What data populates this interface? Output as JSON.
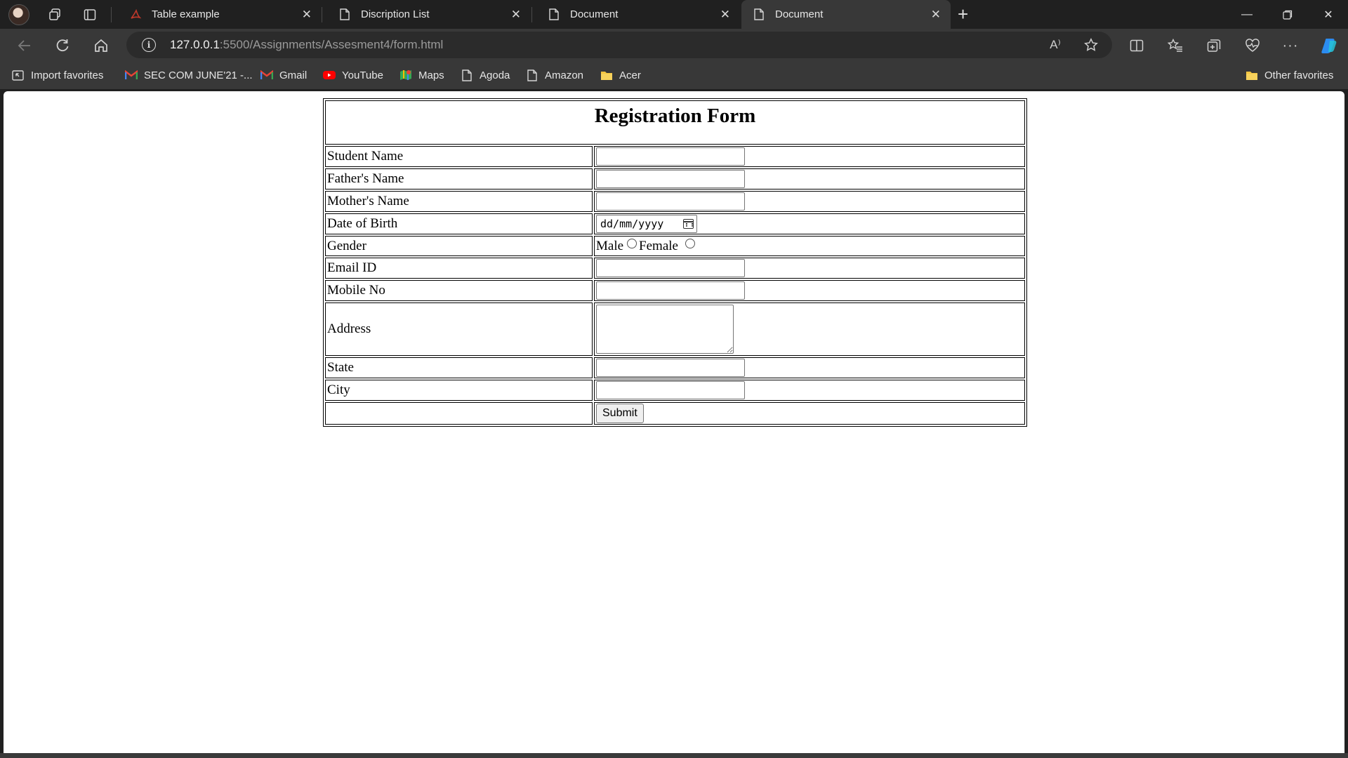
{
  "browser": {
    "tabs": [
      {
        "label": "Table example",
        "active": false
      },
      {
        "label": "Discription List",
        "active": false
      },
      {
        "label": "Document",
        "active": false
      },
      {
        "label": "Document",
        "active": true
      }
    ],
    "url_host": "127.0.0.1",
    "url_rest": ":5500/Assignments/Assesment4/form.html",
    "favorites": [
      {
        "label": "Import favorites",
        "icon": "import-icon"
      },
      {
        "label": "SEC COM JUNE'21 -...",
        "icon": "gmail-icon"
      },
      {
        "label": "Gmail",
        "icon": "gmail-icon"
      },
      {
        "label": "YouTube",
        "icon": "youtube-icon"
      },
      {
        "label": "Maps",
        "icon": "maps-icon"
      },
      {
        "label": "Agoda",
        "icon": "page-icon"
      },
      {
        "label": "Amazon",
        "icon": "page-icon"
      },
      {
        "label": "Acer",
        "icon": "folder-icon"
      }
    ],
    "other_favorites": "Other favorites",
    "read_aloud_glyph": "A⁾"
  },
  "form": {
    "title": "Registration Form",
    "fields": {
      "student_name": "Student Name",
      "father_name": "Father's Name",
      "mother_name": "Mother's Name",
      "dob": "Date of Birth",
      "dob_placeholder": "dd/mm/yyyy",
      "gender": "Gender",
      "gender_male": "Male",
      "gender_female": "Female",
      "email": "Email ID",
      "mobile": "Mobile No",
      "address": "Address",
      "state": "State",
      "city": "City"
    },
    "submit_label": "Submit"
  },
  "colors": {
    "browser_chrome": "#202020",
    "toolbar": "#383838",
    "page_bg": "#ffffff"
  }
}
